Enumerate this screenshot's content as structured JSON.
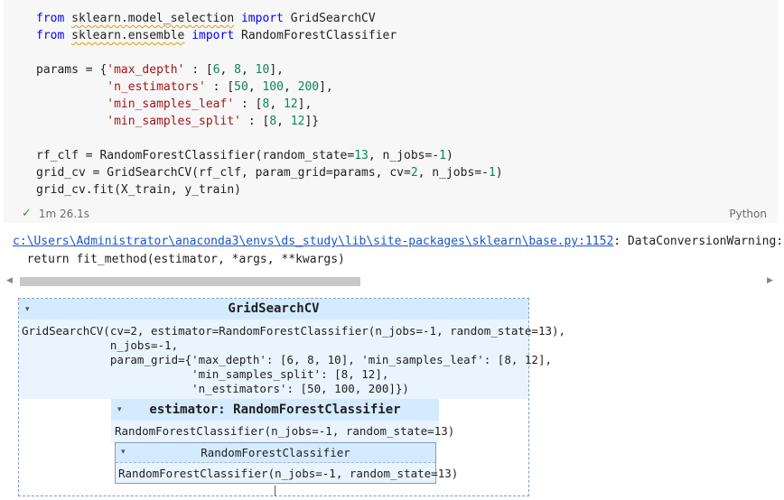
{
  "code_lines": [
    [
      {
        "t": "from",
        "c": "kw"
      },
      {
        "t": " "
      },
      {
        "t": "sklearn.model_selection",
        "c": "squig"
      },
      {
        "t": " "
      },
      {
        "t": "import",
        "c": "kw"
      },
      {
        "t": " GridSearchCV"
      }
    ],
    [
      {
        "t": "from",
        "c": "kw"
      },
      {
        "t": " "
      },
      {
        "t": "sklearn.ensemble",
        "c": "squig"
      },
      {
        "t": " "
      },
      {
        "t": "import",
        "c": "kw"
      },
      {
        "t": " RandomForestClassifier"
      }
    ],
    [],
    [
      {
        "t": "params = {"
      },
      {
        "t": "'max_depth'",
        "c": "str"
      },
      {
        "t": " : ["
      },
      {
        "t": "6",
        "c": "num"
      },
      {
        "t": ", "
      },
      {
        "t": "8",
        "c": "num"
      },
      {
        "t": ", "
      },
      {
        "t": "10",
        "c": "num"
      },
      {
        "t": "],"
      }
    ],
    [
      {
        "t": "          "
      },
      {
        "t": "'n_estimators'",
        "c": "str"
      },
      {
        "t": " : ["
      },
      {
        "t": "50",
        "c": "num"
      },
      {
        "t": ", "
      },
      {
        "t": "100",
        "c": "num"
      },
      {
        "t": ", "
      },
      {
        "t": "200",
        "c": "num"
      },
      {
        "t": "],"
      }
    ],
    [
      {
        "t": "          "
      },
      {
        "t": "'min_samples_leaf'",
        "c": "str"
      },
      {
        "t": " : ["
      },
      {
        "t": "8",
        "c": "num"
      },
      {
        "t": ", "
      },
      {
        "t": "12",
        "c": "num"
      },
      {
        "t": "],"
      }
    ],
    [
      {
        "t": "          "
      },
      {
        "t": "'min_samples_split'",
        "c": "str"
      },
      {
        "t": " : ["
      },
      {
        "t": "8",
        "c": "num"
      },
      {
        "t": ", "
      },
      {
        "t": "12",
        "c": "num"
      },
      {
        "t": "]}"
      }
    ],
    [],
    [
      {
        "t": "rf_clf = RandomForestClassifier(random_state="
      },
      {
        "t": "13",
        "c": "num"
      },
      {
        "t": ", n_jobs=-"
      },
      {
        "t": "1",
        "c": "num"
      },
      {
        "t": ")"
      }
    ],
    [
      {
        "t": "grid_cv = GridSearchCV(rf_clf, param_grid=params, cv="
      },
      {
        "t": "2",
        "c": "num"
      },
      {
        "t": ", n_jobs=-"
      },
      {
        "t": "1",
        "c": "num"
      },
      {
        "t": ")"
      }
    ],
    [
      {
        "t": "grid_cv.fit(X_train, y_train)"
      }
    ]
  ],
  "status": {
    "check_icon": "check-icon",
    "duration": "1m 26.1s",
    "language": "Python"
  },
  "warning": {
    "path": "c:\\Users\\Administrator\\anaconda3\\envs\\ds_study\\lib\\site-packages\\sklearn\\base.py:1152",
    "message": ": DataConversionWarning:",
    "line2": "  return fit_method(estimator, *args, **kwargs)"
  },
  "scrollbar": {
    "thumb_fraction": 0.455
  },
  "estimator_view": {
    "outer_title": "GridSearchCV",
    "outer_repr": "GridSearchCV(cv=2, estimator=RandomForestClassifier(n_jobs=-1, random_state=13),\n             n_jobs=-1,\n             param_grid={'max_depth': [6, 8, 10], 'min_samples_leaf': [8, 12],\n                         'min_samples_split': [8, 12],\n                         'n_estimators': [50, 100, 200]})",
    "estimator_title": "estimator: RandomForestClassifier",
    "estimator_repr": "RandomForestClassifier(n_jobs=-1, random_state=13)",
    "rf_title": "RandomForestClassifier",
    "rf_repr": "RandomForestClassifier(n_jobs=-1, random_state=13)",
    "toggle_glyph": "▾"
  }
}
